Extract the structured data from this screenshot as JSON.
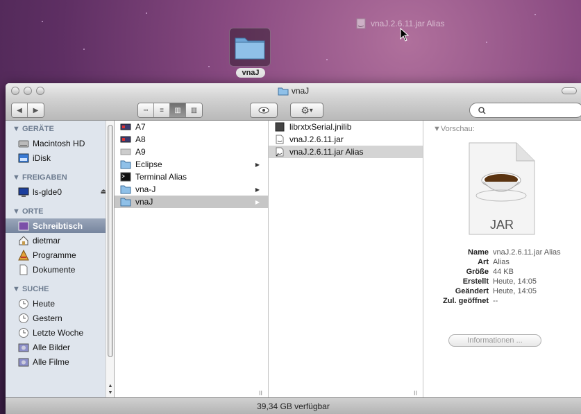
{
  "desktop": {
    "folder_label": "vnaJ",
    "alias_label": "vnaJ.2.6.11.jar Alias"
  },
  "window": {
    "title": "vnaJ",
    "status": "39,34 GB verfügbar",
    "search_placeholder": ""
  },
  "sidebar": {
    "sections": [
      {
        "heading": "▼ GERÄTE",
        "items": [
          {
            "label": "Macintosh HD",
            "icon": "hard-drive-icon"
          },
          {
            "label": "iDisk",
            "icon": "idisk-icon"
          }
        ]
      },
      {
        "heading": "▼ FREIGABEN",
        "items": [
          {
            "label": "ls-glde0",
            "icon": "network-display-icon"
          }
        ]
      },
      {
        "heading": "▼ ORTE",
        "items": [
          {
            "label": "Schreibtisch",
            "icon": "desktop-icon"
          },
          {
            "label": "dietmar",
            "icon": "home-icon"
          },
          {
            "label": "Programme",
            "icon": "applications-icon"
          },
          {
            "label": "Dokumente",
            "icon": "documents-icon"
          }
        ]
      },
      {
        "heading": "▼ SUCHE",
        "items": [
          {
            "label": "Heute",
            "icon": "clock-icon"
          },
          {
            "label": "Gestern",
            "icon": "clock-icon"
          },
          {
            "label": "Letzte Woche",
            "icon": "clock-icon"
          },
          {
            "label": "Alle Bilder",
            "icon": "smart-folder-icon"
          },
          {
            "label": "Alle Filme",
            "icon": "smart-folder-icon"
          }
        ]
      }
    ]
  },
  "column1": [
    {
      "label": "A7",
      "icon": "monitor-alias-icon"
    },
    {
      "label": "A8",
      "icon": "monitor-alias-icon"
    },
    {
      "label": "A9",
      "icon": "monitor-alias-icon"
    },
    {
      "label": "Eclipse",
      "icon": "folder-icon"
    },
    {
      "label": "Terminal Alias",
      "icon": "terminal-icon"
    },
    {
      "label": "vna-J",
      "icon": "folder-icon"
    },
    {
      "label": "vnaJ",
      "icon": "folder-icon"
    }
  ],
  "column2": [
    {
      "label": "librxtxSerial.jnilib",
      "icon": "library-icon"
    },
    {
      "label": "vnaJ.2.6.11.jar",
      "icon": "jar-file-icon"
    },
    {
      "label": "vnaJ.2.6.11.jar Alias",
      "icon": "jar-alias-icon"
    }
  ],
  "preview": {
    "heading": "▼Vorschau:",
    "icon_text": "JAR",
    "meta": [
      {
        "key": "Name",
        "value": "vnaJ.2.6.11.jar Alias"
      },
      {
        "key": "Art",
        "value": "Alias"
      },
      {
        "key": "Größe",
        "value": "44 KB"
      },
      {
        "key": "Erstellt",
        "value": "Heute, 14:05"
      },
      {
        "key": "Geändert",
        "value": "Heute, 14:05"
      },
      {
        "key": "Zul. geöffnet",
        "value": "--"
      }
    ],
    "info_button": "Informationen ..."
  }
}
